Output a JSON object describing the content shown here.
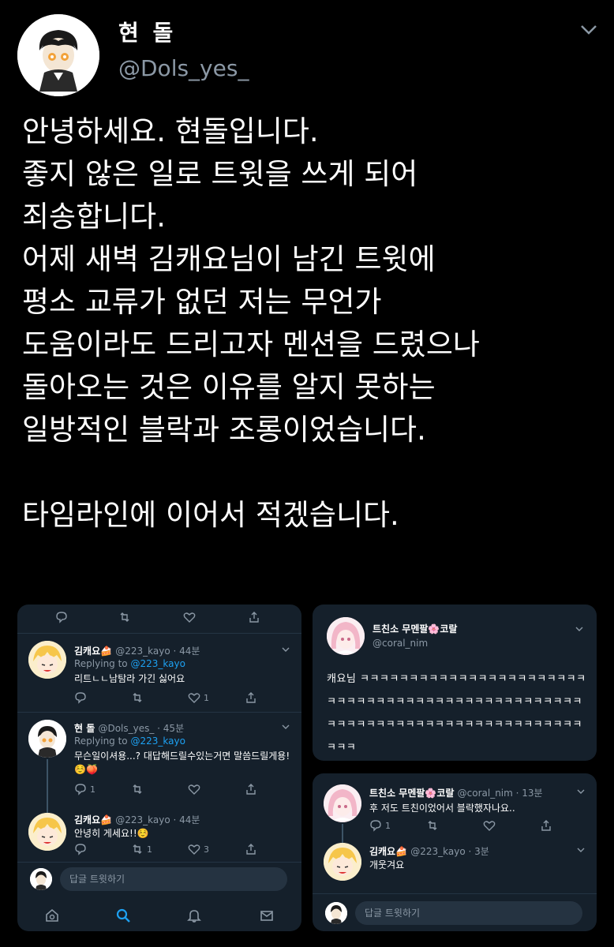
{
  "tweet": {
    "display_name": "현 돌",
    "handle": "@Dols_yes_",
    "body": "안녕하세요. 현돌입니다.\n좋지 않은 일로 트윗을 쓰게 되어\n죄송합니다.\n어제 새벽 김캐요님이 남긴 트윗에\n평소 교류가 없던 저는 무언가\n도움이라도 드리고자 멘션을 드렸으나\n돌아오는 것은 이유를 알지 못하는\n일방적인 블락과 조롱이었습니다.\n\n타임라인에 이어서 적겠습니다."
  },
  "left_panel": {
    "tweets": [
      {
        "name": "김캐요🍰",
        "meta": "@223_kayo · 44분",
        "replying_prefix": "Replying to ",
        "replying_to": "@223_kayo",
        "text": "리트ㄴㄴ남탐라 가긴 싫어요",
        "like_count": "1"
      },
      {
        "name": "현 돌",
        "meta": "@Dols_yes_ · 45분",
        "replying_prefix": "Replying to ",
        "replying_to": "@223_kayo",
        "text": "무슨일이셔용...? 대답해드릴수있는거면 말씀드릴게용!☺️🍑",
        "reply_count": "1"
      },
      {
        "name": "김캐요🍰",
        "meta": "@223_kayo · 44분",
        "text": "안녕히 게세요!!☺️",
        "retweet_count": "1",
        "like_count": "3"
      }
    ],
    "reply_placeholder": "답글 트윗하기"
  },
  "right_top_panel": {
    "name": "트친소 무멘팔🌸코랄",
    "handle": "@coral_nim",
    "text": "캐요님 ㅋㅋㅋㅋㅋㅋㅋㅋㅋㅋㅋㅋㅋㅋㅋㅋㅋㅋㅋㅋㅋㅋㅋㅋㅋㅋㅋㅋㅋㅋㅋㅋㅋㅋㅋㅋㅋㅋㅋㅋㅋㅋㅋㅋㅋㅋㅋㅋㅋㅋㅋㅋㅋㅋㅋㅋㅋㅋㅋㅋㅋㅋㅋㅋㅋㅋㅋㅋㅋㅋㅋㅋㅋㅋㅋㅋㅋㅋ"
  },
  "right_bottom_panel": {
    "tweets": [
      {
        "name": "트친소 무멘팔🌸코랄",
        "meta": "@coral_nim · 13분",
        "text": "후 저도 트친이었어서 블락했자나요..",
        "reply_count": "1"
      },
      {
        "name": "김캐요🍰",
        "meta": "@223_kayo · 3분",
        "text": "개웃겨요"
      }
    ],
    "reply_placeholder": "답글 트윗하기"
  },
  "colors": {
    "background": "#000000",
    "panel": "#15202b",
    "muted": "#8b98a5",
    "accent": "#1da1f2"
  },
  "icons": [
    "reply-icon",
    "retweet-icon",
    "like-icon",
    "share-icon",
    "chevron-down-icon",
    "home-icon",
    "search-icon",
    "notifications-icon",
    "messages-icon"
  ]
}
